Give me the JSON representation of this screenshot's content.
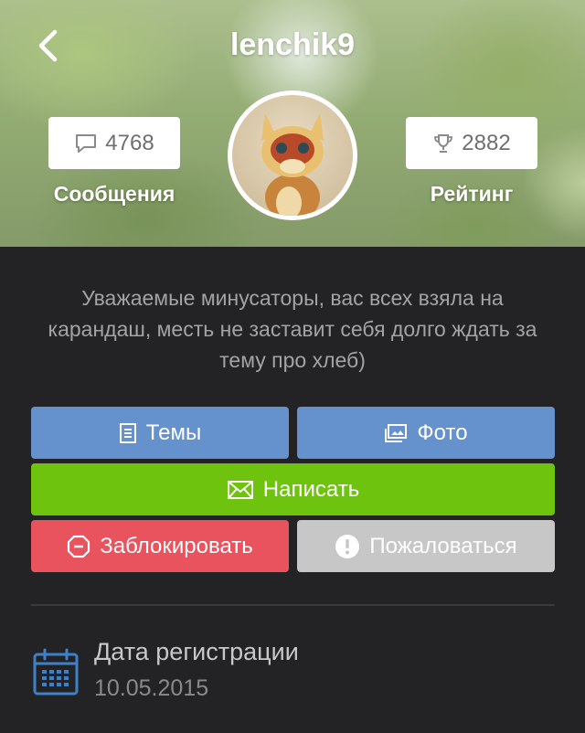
{
  "header": {
    "username": "lenchik9"
  },
  "stats": {
    "messages": {
      "value": "4768",
      "label": "Сообщения",
      "icon": "chat-bubble-icon"
    },
    "rating": {
      "value": "2882",
      "label": "Рейтинг",
      "icon": "trophy-icon"
    }
  },
  "profile": {
    "status_text": "Уважаемые минусаторы, вас всех взяла на карандаш, месть не заставит себя долго ждать за тему про хлеб)"
  },
  "actions": {
    "topics_label": "Темы",
    "photo_label": "Фото",
    "write_label": "Написать",
    "block_label": "Заблокировать",
    "report_label": "Пожаловаться"
  },
  "registration": {
    "title": "Дата регистрации",
    "date": "10.05.2015"
  },
  "colors": {
    "blue_button": "#6591cd",
    "green_button": "#6ec30f",
    "red_button": "#e9535e",
    "gray_button": "#c7c7c7",
    "background": "#232326"
  }
}
